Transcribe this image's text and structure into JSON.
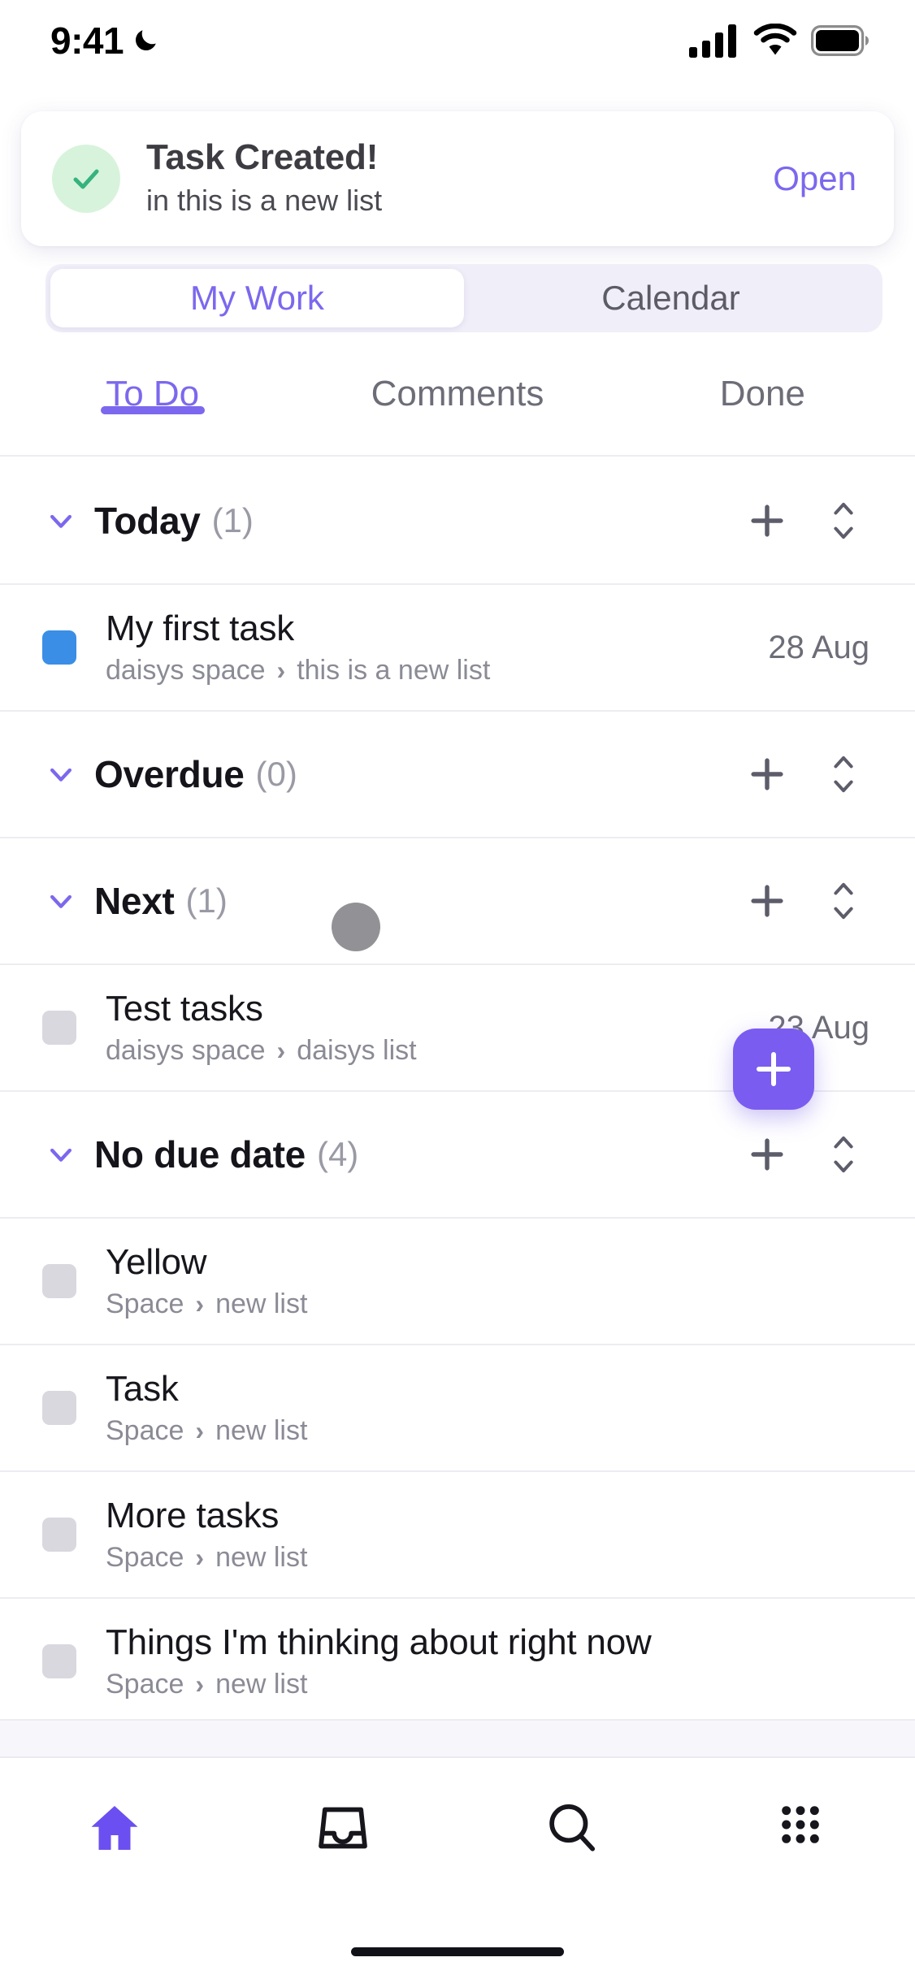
{
  "status_bar": {
    "time": "9:41",
    "moon_icon": "crescent-moon-icon",
    "cellular_icon": "cellular-signal-icon",
    "wifi_icon": "wifi-icon",
    "battery_icon": "battery-full-icon"
  },
  "toast": {
    "icon": "check-circle-icon",
    "title": "Task Created!",
    "subtitle": "in this is a new list",
    "action_label": "Open"
  },
  "segmented": {
    "options": [
      "My Work",
      "Calendar"
    ],
    "selected": "My Work"
  },
  "tabs": {
    "items": [
      {
        "label": "To Do",
        "active": true
      },
      {
        "label": "Comments",
        "active": false
      },
      {
        "label": "Done",
        "active": false
      }
    ]
  },
  "sections": [
    {
      "title": "Today",
      "count": "(1)",
      "chevron_icon": "chevron-down-icon",
      "add_icon": "plus-icon",
      "sort_icon": "sort-updown-icon",
      "tasks": [
        {
          "name": "My first task",
          "space": "daisys space",
          "list": "this is a new list",
          "separator": "›",
          "date": "28 Aug",
          "checkbox_color": "#3a8ee6"
        }
      ]
    },
    {
      "title": "Overdue",
      "count": "(0)",
      "chevron_icon": "chevron-down-icon",
      "add_icon": "plus-icon",
      "sort_icon": "sort-updown-icon",
      "tasks": []
    },
    {
      "title": "Next",
      "count": "(1)",
      "chevron_icon": "chevron-down-icon",
      "add_icon": "plus-icon",
      "sort_icon": "sort-updown-icon",
      "tasks": [
        {
          "name": "Test tasks",
          "space": "daisys space",
          "list": "daisys list",
          "separator": "›",
          "date": "23 Aug",
          "checkbox_color": "#d8d8de"
        }
      ]
    },
    {
      "title": "No due date",
      "count": "(4)",
      "chevron_icon": "chevron-down-icon",
      "add_icon": "plus-icon",
      "sort_icon": "sort-updown-icon",
      "tasks": [
        {
          "name": "Yellow",
          "space": "Space",
          "list": "new list",
          "separator": "›",
          "date": "",
          "checkbox_color": "#d8d8de"
        },
        {
          "name": "Task",
          "space": "Space",
          "list": "new list",
          "separator": "›",
          "date": "",
          "checkbox_color": "#d8d8de"
        },
        {
          "name": "More tasks",
          "space": "Space",
          "list": "new list",
          "separator": "›",
          "date": "",
          "checkbox_color": "#d8d8de"
        },
        {
          "name": "Things I'm thinking about right now",
          "space": "Space",
          "list": "new list",
          "separator": "›",
          "date": "",
          "checkbox_color": "#d8d8de"
        }
      ]
    }
  ],
  "fab": {
    "icon": "plus-icon",
    "color": "#7b5cf0"
  },
  "bottom_nav": {
    "items": [
      {
        "icon": "home-icon",
        "active": true
      },
      {
        "icon": "inbox-tray-icon",
        "active": false
      },
      {
        "icon": "search-icon",
        "active": false
      },
      {
        "icon": "apps-grid-icon",
        "active": false
      }
    ]
  },
  "colors": {
    "accent": "#7b68ee",
    "fab": "#7b5cf0",
    "success": "#36b37e",
    "success_bg": "#d8f3dc",
    "task_blue": "#3a8ee6",
    "checkbox_gray": "#d8d8de",
    "divider": "#ececf2",
    "muted_text": "#8b8b96"
  },
  "touch_indicator": {
    "present": true
  }
}
